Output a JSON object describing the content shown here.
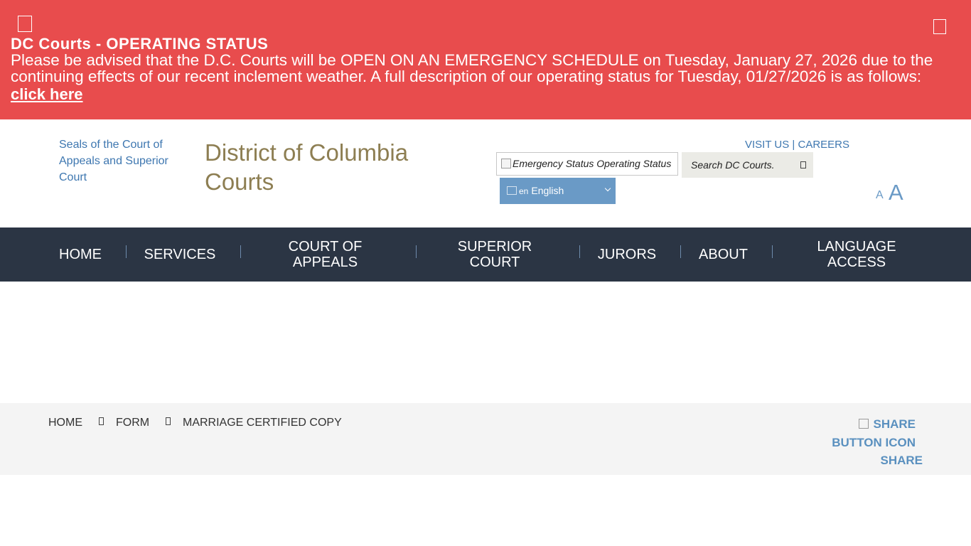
{
  "alert": {
    "title": "DC Courts - OPERATING STATUS",
    "body": "Please be advised that the D.C. Courts will be OPEN ON AN EMERGENCY SCHEDULE on Tuesday, January 27, 2026 due to the continuing effects of our recent inclement weather. A full description of our operating status for Tuesday, 01/27/2026 is as follows:",
    "link": "click here"
  },
  "header": {
    "seal_alt": "Seals of the Court of Appeals and Superior Court",
    "site_title": "District of Columbia Courts",
    "visit_us": "VISIT US",
    "separator": "|",
    "careers": "CAREERS",
    "emergency_status": "Emergency Status Operating Status",
    "search_placeholder": "Search DC Courts.",
    "language_flag_alt": "en",
    "language": "English",
    "font_small": "A",
    "font_large": "A"
  },
  "nav": {
    "items": [
      "HOME",
      "SERVICES",
      "COURT OF APPEALS",
      "SUPERIOR COURT",
      "JURORS",
      "ABOUT",
      "LANGUAGE ACCESS"
    ]
  },
  "breadcrumb": {
    "items": [
      "HOME",
      "FORM",
      "MARRIAGE CERTIFIED COPY"
    ]
  },
  "share": {
    "image_alt": "SHARE BUTTON ICON",
    "label": "SHARE"
  },
  "colors": {
    "alert_bg": "#e84c4d",
    "nav_bg": "#2b3544",
    "title_gold": "#8d7e52",
    "link_blue": "#3e77b0",
    "language_bg": "#6a9ac6"
  }
}
